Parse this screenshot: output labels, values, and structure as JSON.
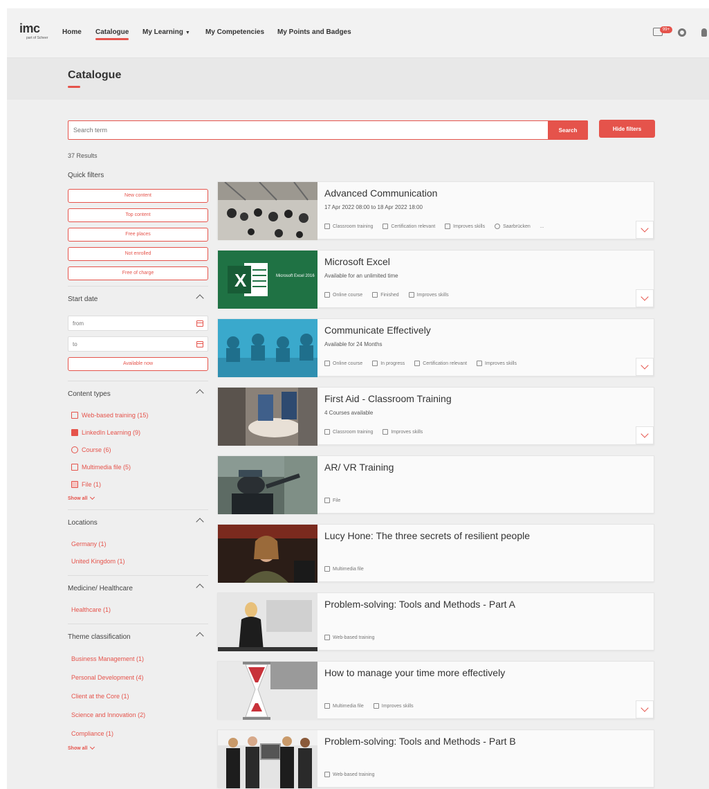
{
  "nav": {
    "logo": "imc",
    "logo_sub": "part of Scheer",
    "items": [
      {
        "label": "Home"
      },
      {
        "label": "Catalogue"
      },
      {
        "label": "My Learning"
      },
      {
        "label": "My Competencies"
      },
      {
        "label": "My Points and Badges"
      }
    ],
    "notification_badge": "99+"
  },
  "page": {
    "title": "Catalogue"
  },
  "search": {
    "placeholder": "Search term",
    "button_label": "Search",
    "hide_filters_label": "Hide filters",
    "results_count": "37 Results"
  },
  "sidebar": {
    "quick_filters_heading": "Quick filters",
    "quick_filters": [
      "New content",
      "Top content",
      "Free places",
      "Not enrolled",
      "Free of charge"
    ],
    "start_date": {
      "heading": "Start date",
      "from_placeholder": "from",
      "to_placeholder": "to",
      "available_now_label": "Available now"
    },
    "content_types": {
      "heading": "Content types",
      "items": [
        "Web-based training (15)",
        "LinkedIn Learning (9)",
        "Course (6)",
        "Multimedia file (5)",
        "File (1)"
      ],
      "show_all": "Show all"
    },
    "locations": {
      "heading": "Locations",
      "items": [
        "Germany (1)",
        "United Kingdom (1)"
      ]
    },
    "medicine": {
      "heading": "Medicine/ Healthcare",
      "items": [
        "Healthcare (1)"
      ]
    },
    "theme": {
      "heading": "Theme classification",
      "items": [
        "Business Management (1)",
        "Personal Development (4)",
        "Client at the Core (1)",
        "Science and Innovation (2)",
        "Compliance (1)"
      ],
      "show_all": "Show all"
    }
  },
  "cards": [
    {
      "title": "Advanced Communication",
      "subtitle": "17 Apr 2022 08:00 to 18 Apr 2022 18:00",
      "meta": [
        "Classroom training",
        "Certification relevant",
        "Improves skills",
        "Saarbrücken",
        "..."
      ],
      "thumb_color": "#b9b5ad"
    },
    {
      "title": "Microsoft Excel",
      "subtitle": "Available for an unlimited time",
      "meta": [
        "Online course",
        "Finished",
        "Improves skills"
      ],
      "thumb_color": "#1f7244",
      "thumb_text": "Microsoft Excel 2016"
    },
    {
      "title": "Communicate Effectively",
      "subtitle": "Available for 24 Months",
      "meta": [
        "Online course",
        "In progress",
        "Certification relevant",
        "Improves skills"
      ],
      "thumb_color": "#3aa9cc"
    },
    {
      "title": "First Aid - Classroom Training",
      "subtitle": "4 Courses available",
      "meta": [
        "Classroom training",
        "Improves skills"
      ],
      "thumb_color": "#6b6560"
    },
    {
      "title": "AR/ VR Training",
      "subtitle": "",
      "meta": [
        "File"
      ],
      "thumb_color": "#4a5a55"
    },
    {
      "title": "Lucy Hone: The three secrets of resilient people",
      "subtitle": "",
      "meta": [
        "Multimedia file"
      ],
      "thumb_color": "#3a2a22"
    },
    {
      "title": "Problem-solving: Tools and Methods - Part A",
      "subtitle": "",
      "meta": [
        "Web-based training"
      ],
      "thumb_color": "#d8d8d8"
    },
    {
      "title": "How to manage your time more effectively",
      "subtitle": "",
      "meta": [
        "Multimedia file",
        "Improves skills"
      ],
      "thumb_color": "#e5e5e5"
    },
    {
      "title": "Problem-solving: Tools and Methods - Part B",
      "subtitle": "",
      "meta": [
        "Web-based training"
      ],
      "thumb_color": "#e0e0e0"
    }
  ],
  "colors": {
    "accent": "#e5534b",
    "background": "#efefef"
  }
}
